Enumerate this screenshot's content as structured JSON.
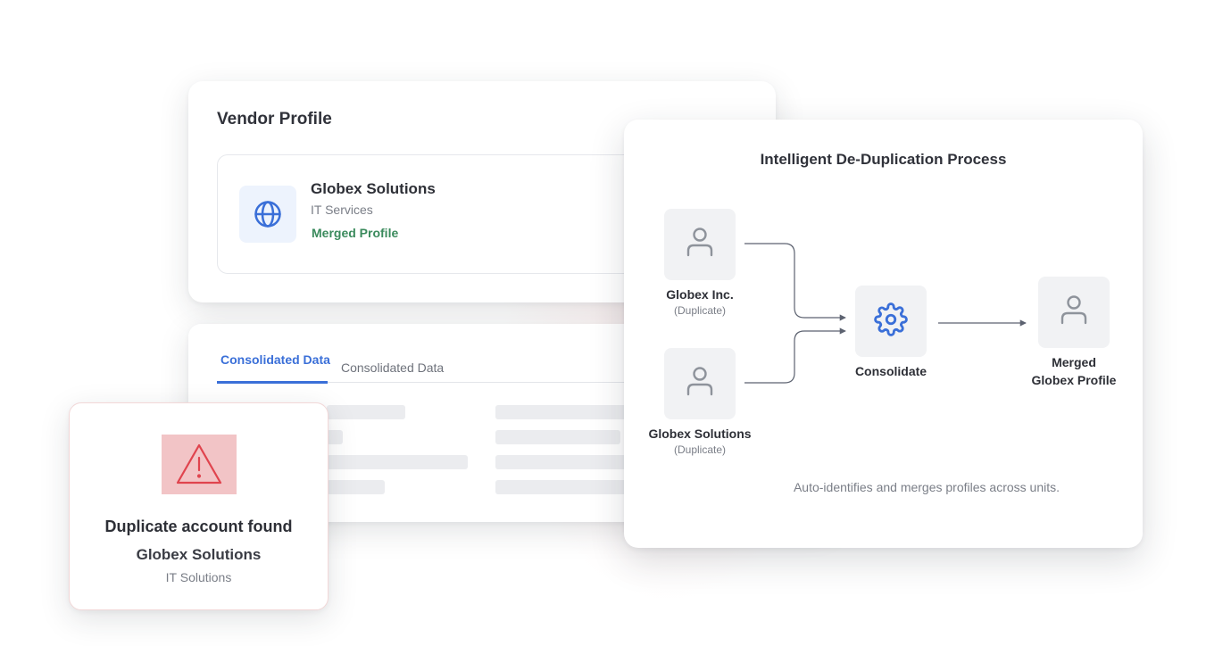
{
  "vendor_profile": {
    "title": "Vendor Profile",
    "icon": "globe-icon",
    "company_name": "Globex Solutions",
    "category": "IT Services",
    "status": "Merged Profile"
  },
  "data_panel": {
    "tabs": [
      {
        "label": "Consolidated Data",
        "active": true
      },
      {
        "label": "Consolidated Data",
        "active": false
      }
    ]
  },
  "alert": {
    "icon": "warning-icon",
    "title": "Duplicate account found",
    "company_name": "Globex Solutions",
    "category": "IT Solutions"
  },
  "process": {
    "title": "Intelligent De-Duplication Process",
    "nodes": {
      "dup1": {
        "label": "Globex Inc.",
        "sub": "(Duplicate)",
        "icon": "user-icon"
      },
      "dup2": {
        "label": "Globex Solutions",
        "sub": "(Duplicate)",
        "icon": "user-icon"
      },
      "consolidate": {
        "label": "Consolidate",
        "icon": "gear-icon"
      },
      "merged": {
        "label_line1": "Merged",
        "label_line2": "Globex Profile",
        "icon": "user-icon"
      }
    },
    "footer": "Auto-identifies and merges profiles across units."
  },
  "colors": {
    "accent_blue": "#3a6fd8",
    "success_green": "#3a8a5c",
    "warning_red": "#e0444e",
    "warning_bg": "#f2c4c6"
  }
}
